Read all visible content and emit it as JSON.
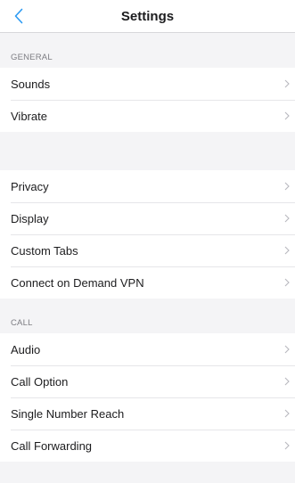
{
  "nav": {
    "title": "Settings",
    "back_icon": "chevron-left-icon",
    "accent_color": "#2b9af3"
  },
  "sections": [
    {
      "header": "GENERAL",
      "items": [
        {
          "label": "Sounds"
        },
        {
          "label": "Vibrate"
        }
      ]
    },
    {
      "header": "",
      "items": [
        {
          "label": "Privacy"
        },
        {
          "label": "Display"
        },
        {
          "label": "Custom Tabs"
        },
        {
          "label": "Connect on Demand VPN"
        }
      ]
    },
    {
      "header": "CALL",
      "items": [
        {
          "label": "Audio"
        },
        {
          "label": "Call Option"
        },
        {
          "label": "Single Number Reach"
        },
        {
          "label": "Call Forwarding"
        }
      ]
    }
  ],
  "row_icon": "chevron-right-icon"
}
